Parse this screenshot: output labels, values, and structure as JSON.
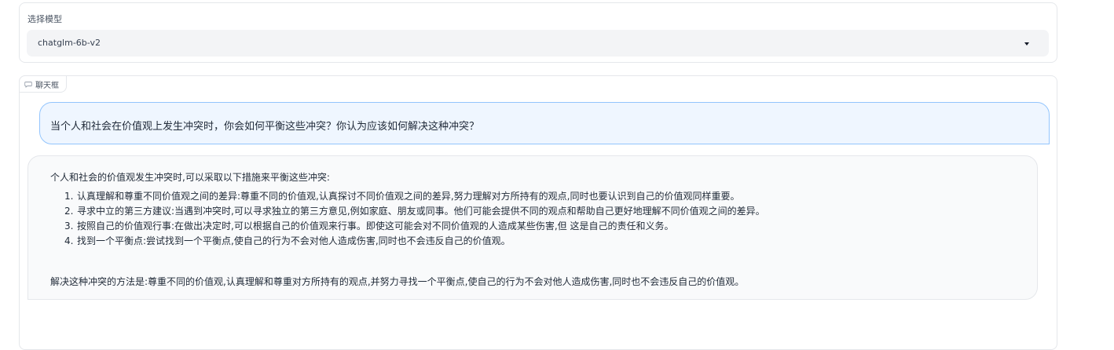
{
  "model_selector": {
    "label": "选择模型",
    "selected": "chatglm-6b-v2"
  },
  "chatbox": {
    "label": "聊天框",
    "user_message": "当个人和社会在价值观上发生冲突时，你会如何平衡这些冲突？你认为应该如何解决这种冲突？",
    "bot_intro": "个人和社会的价值观发生冲突时,可以采取以下措施来平衡这些冲突:",
    "bot_items": [
      {
        "num": "1.",
        "text": "认真理解和尊重不同价值观之间的差异:尊重不同的价值观,认真探讨不同价值观之间的差异,努力理解对方所持有的观点,同时也要认识到自己的价值观同样重要。"
      },
      {
        "num": "2.",
        "text": "寻求中立的第三方建议:当遇到冲突时,可以寻求独立的第三方意见,例如家庭、朋友或同事。他们可能会提供不同的观点和帮助自己更好地理解不同价值观之间的差异。"
      },
      {
        "num": "3.",
        "text": "按照自己的价值观行事:在做出决定时,可以根据自己的价值观来行事。即使这可能会对不同价值观的人造成某些伤害,但 这是自己的责任和义务。"
      },
      {
        "num": "4.",
        "text": "找到一个平衡点:尝试找到一个平衡点,使自己的行为不会对他人造成伤害,同时也不会违反自己的价值观。"
      }
    ],
    "bot_summary": "解决这种冲突的方法是:尊重不同的价值观,认真理解和尊重对方所持有的观点,并努力寻找一个平衡点,使自己的行为不会对他人造成伤害,同时也不会违反自己的价值观。"
  },
  "icons": {
    "chat": "chat-bubble-icon",
    "dropdown": "chevron-down-icon"
  }
}
